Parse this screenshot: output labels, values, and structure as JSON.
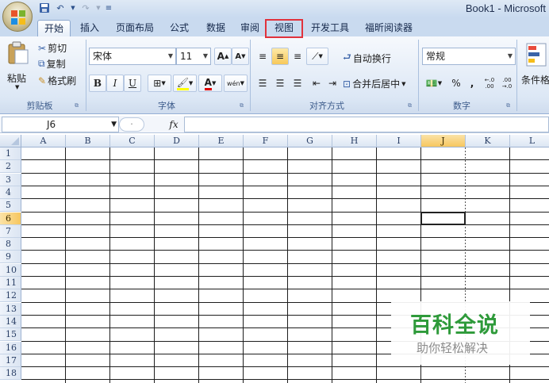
{
  "window": {
    "title": "Book1 - Microsoft"
  },
  "tabs": [
    {
      "label": "开始",
      "active": true
    },
    {
      "label": "插入"
    },
    {
      "label": "页面布局"
    },
    {
      "label": "公式"
    },
    {
      "label": "数据"
    },
    {
      "label": "审阅"
    },
    {
      "label": "视图"
    },
    {
      "label": "开发工具"
    },
    {
      "label": "福昕阅读器"
    }
  ],
  "clipboard": {
    "paste": "粘贴",
    "cut": "剪切",
    "copy": "复制",
    "format_painter": "格式刷",
    "group_label": "剪贴板"
  },
  "font": {
    "name": "宋体",
    "size": "11",
    "grow": "A",
    "shrink": "A",
    "bold": "B",
    "italic": "I",
    "underline": "U",
    "font_color": "A",
    "phonetic": "wén",
    "group_label": "字体"
  },
  "alignment": {
    "wrap_text": "自动换行",
    "merge_center": "合并后居中",
    "group_label": "对齐方式"
  },
  "number": {
    "format": "常规",
    "percent": "%",
    "comma": ",",
    "inc_decimal": "←.0 .00",
    "dec_decimal": ".00 →.0",
    "group_label": "数字"
  },
  "styles": {
    "conditional_format": "条件格"
  },
  "formula_bar": {
    "cell_ref": "J6",
    "fx": "fx",
    "content": ""
  },
  "columns": [
    "A",
    "B",
    "C",
    "D",
    "E",
    "F",
    "G",
    "H",
    "I",
    "J",
    "K",
    "L"
  ],
  "rows": [
    "1",
    "2",
    "3",
    "4",
    "5",
    "6",
    "7",
    "8",
    "9",
    "10",
    "11",
    "12",
    "13",
    "14",
    "15",
    "16",
    "17",
    "18"
  ],
  "selected_cell": {
    "column": "J",
    "row": "6"
  },
  "watermark": {
    "title": "百科全说",
    "subtitle": "助你轻松解决"
  },
  "colors": {
    "highlight": "#e1323c",
    "watermark": "#2e9a3a",
    "selected_header": "#f6c65f"
  }
}
